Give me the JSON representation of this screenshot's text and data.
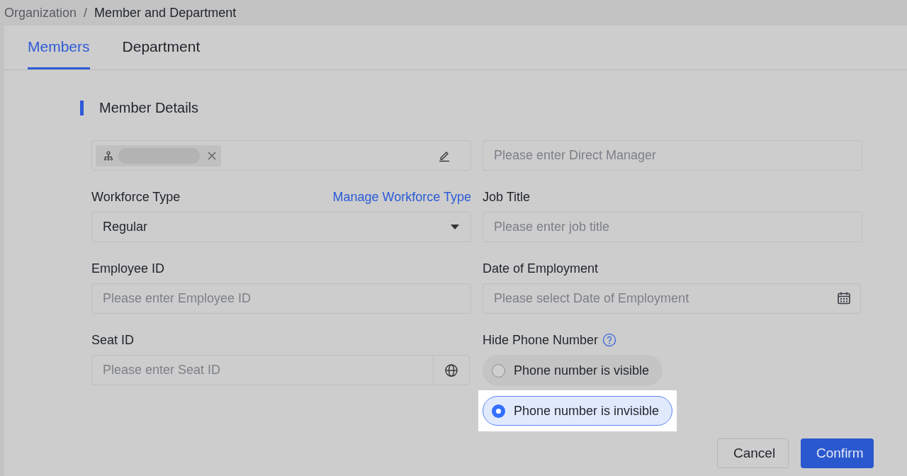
{
  "breadcrumb": {
    "items": [
      {
        "label": "Organization",
        "current": false
      },
      {
        "label": "Member and Department",
        "current": true
      }
    ],
    "separator": "/"
  },
  "tabs": [
    {
      "label": "Members",
      "selected": true
    },
    {
      "label": "Department",
      "selected": false
    }
  ],
  "section_title": "Member Details",
  "fields": [
    {
      "kind": "tag"
    },
    {
      "kind": "text",
      "placeholder": "Please enter Direct Manager"
    },
    {
      "kind": "select",
      "label": "Workforce Type",
      "link": "Manage Workforce Type",
      "value": "Regular"
    },
    {
      "kind": "text",
      "label": "Job Title",
      "placeholder": "Please enter job title"
    },
    {
      "kind": "text",
      "label": "Employee ID",
      "placeholder": "Please enter Employee ID"
    },
    {
      "kind": "date",
      "label": "Date of Employment",
      "placeholder": "Please select Date of Employment"
    },
    {
      "kind": "addon",
      "label": "Seat ID",
      "placeholder": "Please enter Seat ID"
    },
    {
      "kind": "radio",
      "label": "Hide Phone Number",
      "options": [
        {
          "label": "Phone number is visible",
          "selected": false
        },
        {
          "label": "Phone number is invisible",
          "selected": true
        }
      ]
    }
  ],
  "buttons": [
    {
      "label": "Cancel",
      "kind": "secondary"
    },
    {
      "label": "Confirm",
      "kind": "primary"
    }
  ]
}
